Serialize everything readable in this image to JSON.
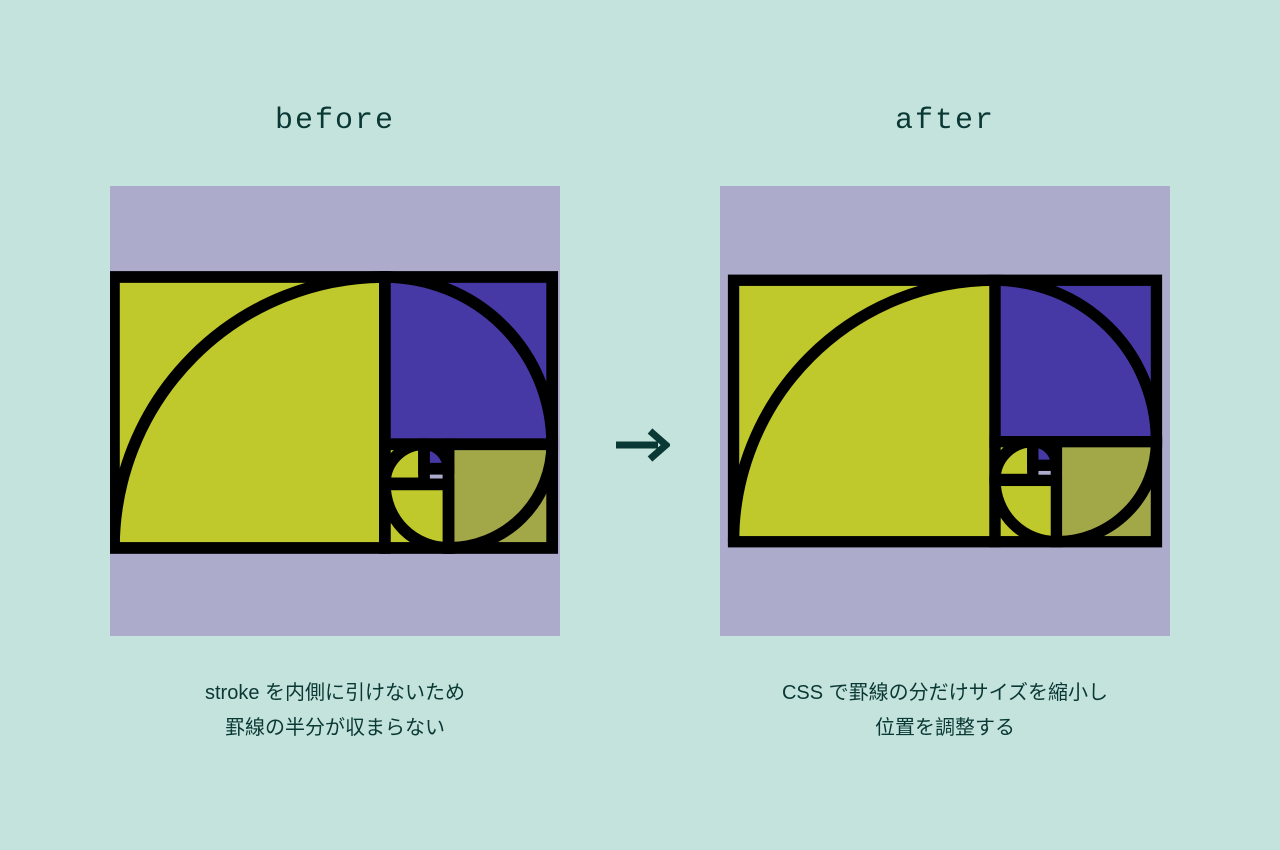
{
  "left": {
    "title": "before",
    "caption_line1": "stroke を内側に引けないため",
    "caption_line2": "罫線の半分が収まらない"
  },
  "right": {
    "title": "after",
    "caption_line1": "CSS で罫線の分だけサイズを縮小し",
    "caption_line2": "位置を調整する"
  },
  "colors": {
    "bg": "#c5e3dd",
    "canvas": "#acabcc",
    "yellowgreen": "#c0c92b",
    "blue": "#4639a5",
    "olive": "#a2a747",
    "stroke": "#000000",
    "text": "#0a3834"
  }
}
